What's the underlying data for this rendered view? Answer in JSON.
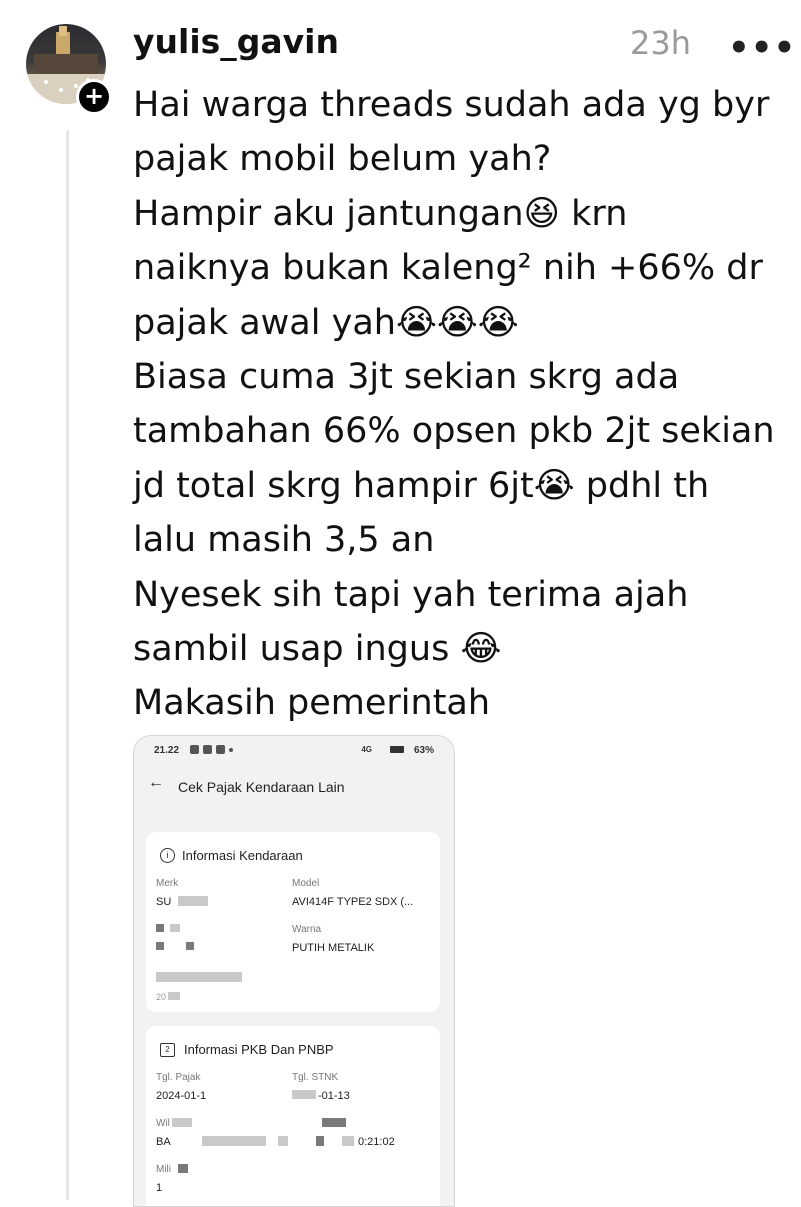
{
  "post": {
    "username": "yulis_gavin",
    "time": "23h",
    "more_label": "•••",
    "follow_label": "+",
    "lines": [
      "Hai warga threads sudah ada yg byr",
      "pajak mobil belum yah?",
      "Hampir aku jantungan😆 krn",
      "naiknya bukan kaleng² nih +66% dr",
      "pajak awal yah😭😭😭",
      "Biasa cuma 3jt sekian skrg ada",
      "tambahan 66% opsen pkb 2jt sekian",
      "jd total skrg hampir 6jt😭 pdhl th",
      "lalu masih 3,5 an",
      "Nyesek sih tapi yah terima ajah",
      "sambil usap ingus 😂",
      "Makasih pemerintah"
    ]
  },
  "screenshot": {
    "status_time": "21.22",
    "status_right": "63%",
    "status_net": "4G",
    "back_icon": "arrow-left-icon",
    "page_title": "Cek Pajak Kendaraan Lain",
    "card1": {
      "title": "Informasi Kendaraan",
      "merk_label": "Merk",
      "merk_value": "SU",
      "model_label": "Model",
      "model_value": "AVI414F TYPE2 SDX (...",
      "warna_label": "Warna",
      "warna_value": "PUTIH METALIK",
      "extra_value": "20"
    },
    "card2": {
      "title": "Informasi PKB Dan PNBP",
      "tgl_pajak_label": "Tgl. Pajak",
      "tgl_pajak_value": "2024-01-1",
      "tgl_stnk_label": "Tgl. STNK",
      "tgl_stnk_value": "-01-13",
      "wil_label": "Wil",
      "wil_value": "BA",
      "time_value": "0:21:02",
      "milik_label": "Mili",
      "milik_value": "1"
    }
  }
}
